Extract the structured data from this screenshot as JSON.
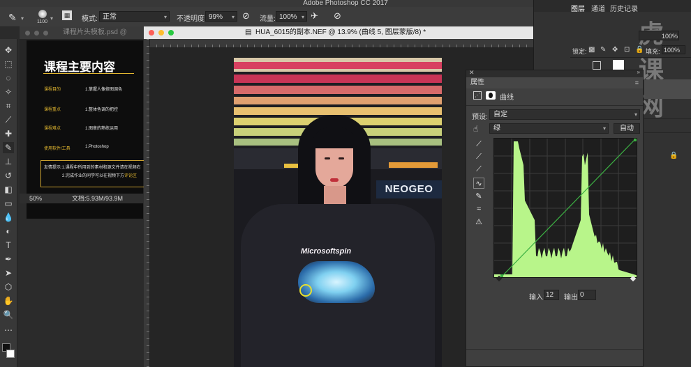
{
  "app": {
    "title": "Adobe Photoshop CC 2017"
  },
  "options_bar": {
    "brush_size": "1100",
    "mode_label": "模式:",
    "mode_value": "正常",
    "opacity_label": "不透明度:",
    "opacity_value": "99%",
    "flow_label": "流量:",
    "flow_value": "100%"
  },
  "doc1": {
    "tab_title": "课程片头模板.psd @",
    "heading": "课程主要内容",
    "rows": [
      {
        "label": "课程目的",
        "value": "1.掌握人像修图调色"
      },
      {
        "label": "课程重点",
        "value": "1.整体色调的把控"
      },
      {
        "label": "课程难点",
        "value": "1.图章的熟练运用"
      },
      {
        "label": "使用软件/工具",
        "value": "1.Photoshop"
      }
    ],
    "tip_line1": "友情提示:1.课程中所用到的素材和源文件请在视频右",
    "tip_line2": "2.完成作业的同学可以在视频下方",
    "tip_highlight": "评论区",
    "zoom": "50%",
    "file_size": "文档:5.93M/93.9M"
  },
  "doc2": {
    "tab_title": "HUA_6015的副本.NEF @ 13.9% (曲线 5, 图层蒙版/8) *",
    "shirt_text": "Microsoftspin",
    "sign_text": "NEOGEO"
  },
  "right_panel": {
    "tabs": [
      "图层",
      "通道",
      "历史记录"
    ],
    "opacity_value": "100%",
    "lock_label": "锁定:",
    "fill_label": "填充:",
    "fill_value": "100%",
    "watermark": "虎课网"
  },
  "properties": {
    "panel_title": "属性",
    "adjustment_name": "曲线",
    "preset_label": "预设:",
    "preset_value": "自定",
    "channel_value": "绿",
    "auto_button": "自动",
    "input_label": "输入:",
    "input_value": "12",
    "output_label": "输出:",
    "output_value": "0",
    "histogram_color": "#b8f58a",
    "curve_color": "#3cb043"
  }
}
